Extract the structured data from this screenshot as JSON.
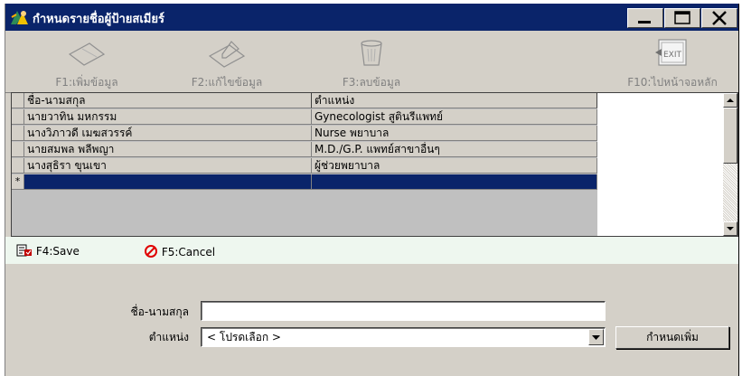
{
  "window": {
    "title": "กำหนดรายชื่อผู้ป้ายสเมียร์"
  },
  "toolbar": {
    "items": [
      {
        "label": "F1:เพิ่มข้อมูล",
        "icon": "add-document-icon"
      },
      {
        "label": "F2:แก้ไขข้อมูล",
        "icon": "edit-document-icon"
      },
      {
        "label": "F3:ลบข้อมูล",
        "icon": "trash-icon"
      },
      {
        "label": "F10:ไปหน้าจอหลัก",
        "icon": "exit-icon"
      }
    ]
  },
  "grid": {
    "columns": [
      "ชื่อ-นามสกุล",
      "ตำแหน่ง"
    ],
    "rows": [
      [
        "นายวาทิน มหกรรม",
        "Gynecologist สูตินรีแพทย์"
      ],
      [
        "นางวิภาวดี เมฆสวรรค์",
        "Nurse พยาบาล"
      ],
      [
        "นายสมพล พลีพญา",
        "M.D./G.P. แพทย์สาขาอื่นๆ"
      ],
      [
        "นางสุธิรา ขุนเขา",
        "ผู้ช่วยพยาบาล"
      ]
    ],
    "new_row_marker": "*"
  },
  "actions": {
    "save_label": "F4:Save",
    "cancel_label": "F5:Cancel"
  },
  "form": {
    "name_label": "ชื่อ-นามสกุล",
    "name_value": "",
    "position_label": "ตำแหน่ง",
    "position_selected": "< โปรดเลือก >",
    "define_more_button": "กำหนดเพิ่ม"
  },
  "colors": {
    "titlebar": "#0a246a",
    "selected_row": "#0a246a",
    "face": "#d4d0c8",
    "action_bar": "#eef7ef"
  }
}
